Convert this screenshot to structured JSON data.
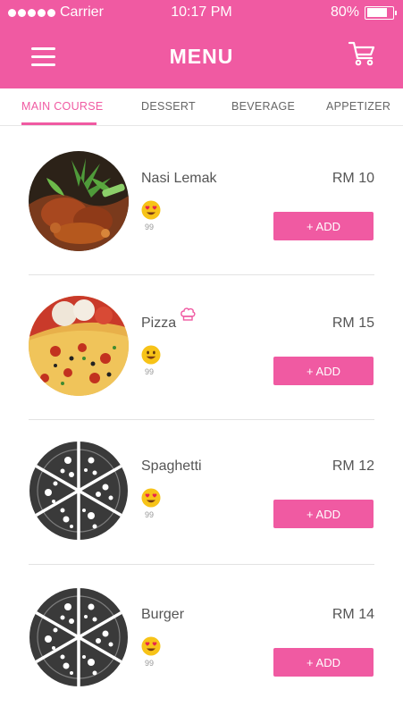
{
  "status_bar": {
    "carrier": "Carrier",
    "time": "10:17 PM",
    "battery": "80%",
    "battery_level": 0.8
  },
  "header": {
    "title": "MENU",
    "menu_icon": "hamburger-icon",
    "cart_icon": "cart-icon"
  },
  "tabs": [
    {
      "label": "MAIN COURSE",
      "active": true
    },
    {
      "label": "DESSERT",
      "active": false
    },
    {
      "label": "BEVERAGE",
      "active": false
    },
    {
      "label": "APPETIZER",
      "active": false
    }
  ],
  "items": [
    {
      "name": "Nasi Lemak",
      "price": "RM 10",
      "reaction_icon": "heart-eyes-emoji",
      "count": "99",
      "add_label": "+ ADD",
      "image": "nasi-lemak-photo"
    },
    {
      "name": "Pizza",
      "price": "RM 15",
      "reaction_icon": "smile-emoji",
      "count": "99",
      "add_label": "+ ADD",
      "image": "pizza-photo",
      "badge_icon": "chef-hat-icon"
    },
    {
      "name": "Spaghetti",
      "price": "RM 12",
      "reaction_icon": "heart-eyes-emoji",
      "count": "99",
      "add_label": "+ ADD",
      "image": "pizza-placeholder-icon"
    },
    {
      "name": "Burger",
      "price": "RM 14",
      "reaction_icon": "heart-eyes-emoji",
      "count": "99",
      "add_label": "+ ADD",
      "image": "pizza-placeholder-icon"
    }
  ],
  "colors": {
    "brand": "#f05aa2",
    "text": "#555555",
    "placeholder": "#3a3a3a"
  }
}
